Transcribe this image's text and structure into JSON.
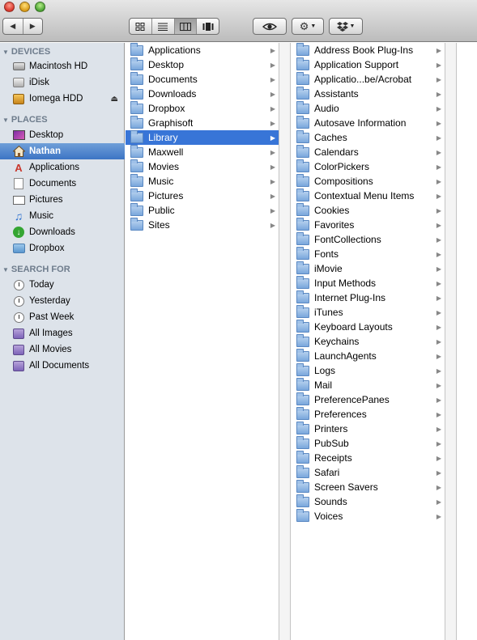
{
  "toolbar": {
    "nav": [
      "back-icon",
      "forward-icon"
    ],
    "views": [
      "icon-view",
      "list-view",
      "column-view",
      "coverflow-view"
    ],
    "active_view": 2
  },
  "sidebar": {
    "devices_header": "DEVICES",
    "devices": [
      {
        "label": "Macintosh HD",
        "icon": "hard-disk-icon"
      },
      {
        "label": "iDisk",
        "icon": "idisk-icon"
      },
      {
        "label": "Iomega HDD",
        "icon": "external-drive-icon",
        "eject": true
      }
    ],
    "places_header": "PLACES",
    "places": [
      {
        "label": "Desktop",
        "icon": "desktop-icon"
      },
      {
        "label": "Nathan",
        "icon": "home-icon",
        "selected": true
      },
      {
        "label": "Applications",
        "icon": "applications-icon"
      },
      {
        "label": "Documents",
        "icon": "documents-icon"
      },
      {
        "label": "Pictures",
        "icon": "pictures-icon"
      },
      {
        "label": "Music",
        "icon": "music-icon"
      },
      {
        "label": "Downloads",
        "icon": "downloads-icon"
      },
      {
        "label": "Dropbox",
        "icon": "dropbox-folder-icon"
      }
    ],
    "search_header": "SEARCH FOR",
    "searches": [
      {
        "label": "Today",
        "icon": "clock-icon"
      },
      {
        "label": "Yesterday",
        "icon": "clock-icon"
      },
      {
        "label": "Past Week",
        "icon": "clock-icon"
      },
      {
        "label": "All Images",
        "icon": "smart-folder-icon"
      },
      {
        "label": "All Movies",
        "icon": "smart-folder-icon"
      },
      {
        "label": "All Documents",
        "icon": "smart-folder-icon"
      }
    ]
  },
  "column1": {
    "items": [
      "Applications",
      "Desktop",
      "Documents",
      "Downloads",
      "Dropbox",
      "Graphisoft",
      "Library",
      "Maxwell",
      "Movies",
      "Music",
      "Pictures",
      "Public",
      "Sites"
    ],
    "selected_index": 6
  },
  "column2": {
    "items": [
      "Address Book Plug-Ins",
      "Application Support",
      "Applicatio...be/Acrobat",
      "Assistants",
      "Audio",
      "Autosave Information",
      "Caches",
      "Calendars",
      "ColorPickers",
      "Compositions",
      "Contextual Menu Items",
      "Cookies",
      "Favorites",
      "FontCollections",
      "Fonts",
      "iMovie",
      "Input Methods",
      "Internet Plug-Ins",
      "iTunes",
      "Keyboard Layouts",
      "Keychains",
      "LaunchAgents",
      "Logs",
      "Mail",
      "PreferencePanes",
      "Preferences",
      "Printers",
      "PubSub",
      "Receipts",
      "Safari",
      "Screen Savers",
      "Sounds",
      "Voices"
    ]
  }
}
